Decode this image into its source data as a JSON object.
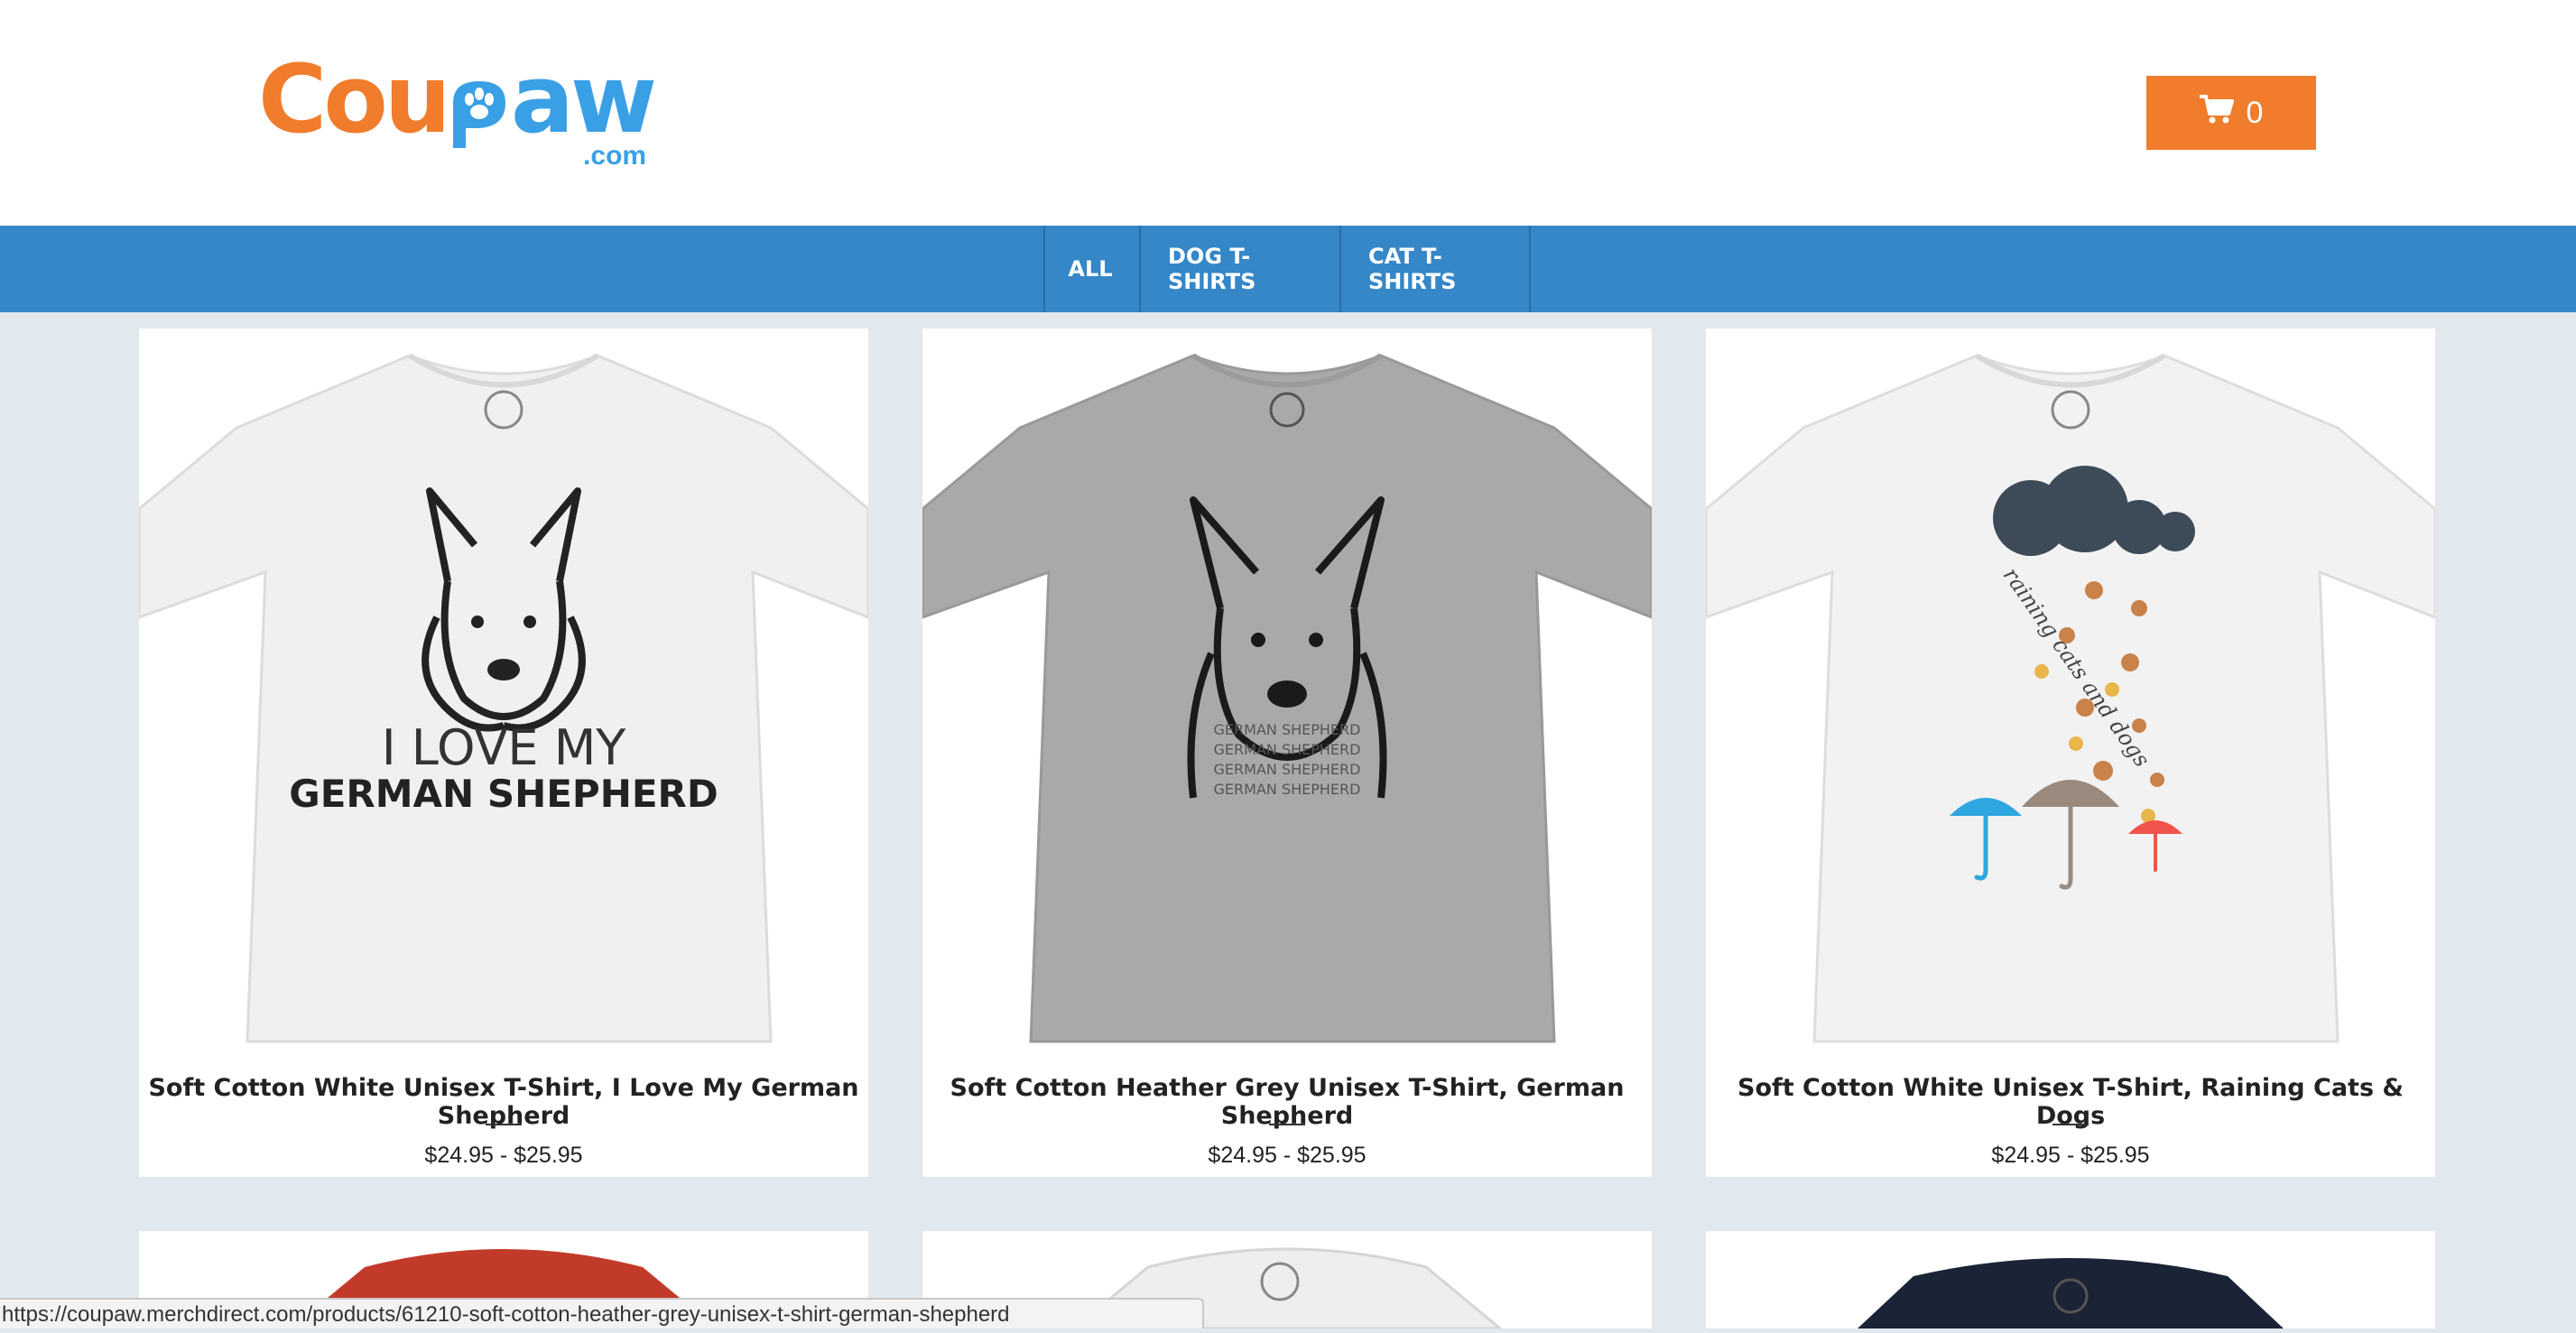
{
  "header": {
    "logo": {
      "part1": "Cou",
      "part2": "aw",
      "domain": ".com"
    },
    "cart": {
      "count": "0",
      "icon": "cart-icon"
    }
  },
  "nav": {
    "items": [
      "ALL",
      "DOG T-SHIRTS",
      "CAT T-SHIRTS"
    ]
  },
  "products": [
    {
      "title": "Soft Cotton White Unisex T-Shirt, I Love My German Shepherd",
      "price": "$24.95 - $25.95",
      "print_line1": "I LOVE MY",
      "print_line2": "GERMAN SHEPHERD",
      "shirt_color": "#f0f0f0"
    },
    {
      "title": "Soft Cotton Heather Grey Unisex T-Shirt, German Shepherd",
      "price": "$24.95 - $25.95",
      "print_line1": "GERMAN SHEPHERD",
      "shirt_color": "#a9a9a9"
    },
    {
      "title": "Soft Cotton White Unisex T-Shirt, Raining Cats & Dogs",
      "price": "$24.95 - $25.95",
      "print_line1": "raining cats and dogs",
      "shirt_color": "#f2f2f2"
    }
  ],
  "more_products": [
    {
      "shirt_color": "#c23b2a"
    },
    {
      "shirt_color": "#eeeeee"
    },
    {
      "shirt_color": "#1b2336"
    }
  ],
  "status_bar": {
    "url": "https://coupaw.merchdirect.com/products/61210-soft-cotton-heather-grey-unisex-t-shirt-german-shepherd"
  }
}
